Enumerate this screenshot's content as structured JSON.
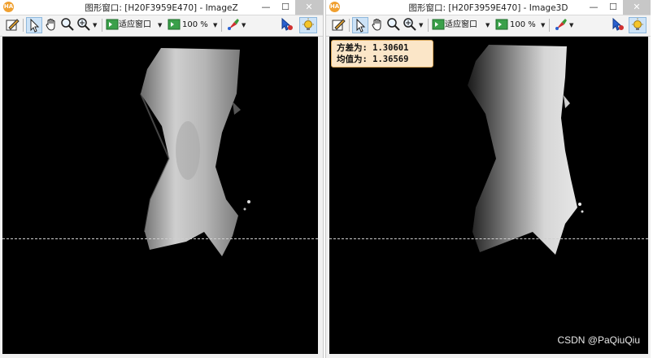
{
  "app_icon": "HA",
  "windows": [
    {
      "title": "图形窗口: [H20F3959E470] - ImageZ",
      "toolbar": {
        "fit_label": "适应窗口",
        "zoom_label": "100 %"
      }
    },
    {
      "title": "图形窗口: [H20F3959E470] - Image3D",
      "toolbar": {
        "fit_label": "适应窗口",
        "zoom_label": "100 %"
      },
      "info": {
        "variance_label": "方差为:",
        "variance_value": "1.30601",
        "mean_label": "均值为:",
        "mean_value": "1.36569"
      }
    }
  ],
  "window_buttons": {
    "minimize": "—",
    "maximize": "☐",
    "close": "✕"
  },
  "watermark": "CSDN @PaQiuQiu",
  "icons": [
    "edit-icon",
    "pointer-icon",
    "hand-icon",
    "magnify-icon",
    "zoom-in-icon",
    "fit-window-icon",
    "zoom-icon",
    "color-icon",
    "inspect-icon",
    "light-icon"
  ]
}
